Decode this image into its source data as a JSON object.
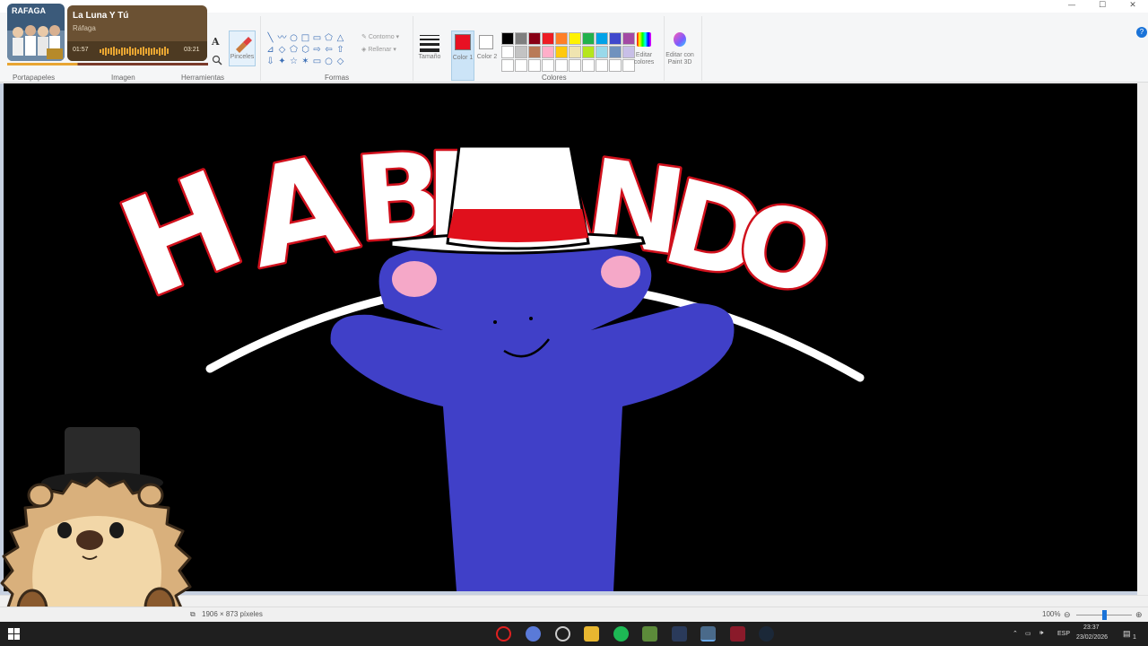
{
  "window": {
    "controls": [
      "—",
      "☐",
      "✕"
    ]
  },
  "media": {
    "album_art_label": "RAFAGA",
    "song": "La Luna Y Tú",
    "artist": "Ráfaga",
    "current_time": "01:57",
    "total_time": "03:21",
    "progress": 0.35
  },
  "ribbon": {
    "groups": {
      "clipboard": "Portapapeles",
      "image": "Imagen",
      "tools": "Herramientas",
      "shapes": "Formas",
      "colors": "Colores"
    },
    "brushes_label": "Pinceles",
    "outline_label": "Contorno",
    "fill_label": "Rellenar",
    "size_label": "Tamaño",
    "color1_label": "Color 1",
    "color2_label": "Color 2",
    "edit_colors_label": "Editar colores",
    "paint3d_label": "Editar con Paint 3D",
    "text_tool_glyph": "A",
    "help_glyph": "?",
    "palette": [
      "#000000",
      "#7f7f7f",
      "#880015",
      "#ed1c24",
      "#ff7f27",
      "#fff200",
      "#22b14c",
      "#00a2e8",
      "#3f48cc",
      "#a349a4",
      "#ffffff",
      "#c3c3c3",
      "#b97a57",
      "#ffaec9",
      "#ffc90e",
      "#efe4b0",
      "#b5e61d",
      "#99d9ea",
      "#7092be",
      "#c8bfe7",
      "#ffffff",
      "#ffffff",
      "#ffffff",
      "#ffffff",
      "#ffffff",
      "#ffffff",
      "#ffffff",
      "#ffffff",
      "#ffffff",
      "#ffffff"
    ],
    "color1": "#e81123",
    "color2": "#ffffff",
    "shape_glyphs": [
      "╲",
      "〰",
      "○",
      "□",
      "▭",
      "⬠",
      "△",
      "⊿",
      "◇",
      "⬠",
      "⬡",
      "⇨",
      "⇦",
      "⇧",
      "⇩",
      "✦",
      "☆",
      "✶",
      "▭",
      "○",
      "◇"
    ]
  },
  "canvas": {
    "background": "#000000",
    "lettering": "HABLANDO",
    "creature_color": "#4040c8",
    "hat_band_color": "#e0101c",
    "ear_color": "#f5a8c8"
  },
  "status": {
    "dimensions": "1906 × 873 píxeles",
    "zoom": "100%"
  },
  "taskbar": {
    "language": "ESP",
    "time": "23:37",
    "date": "23/02/2026",
    "notification_count": "1"
  }
}
